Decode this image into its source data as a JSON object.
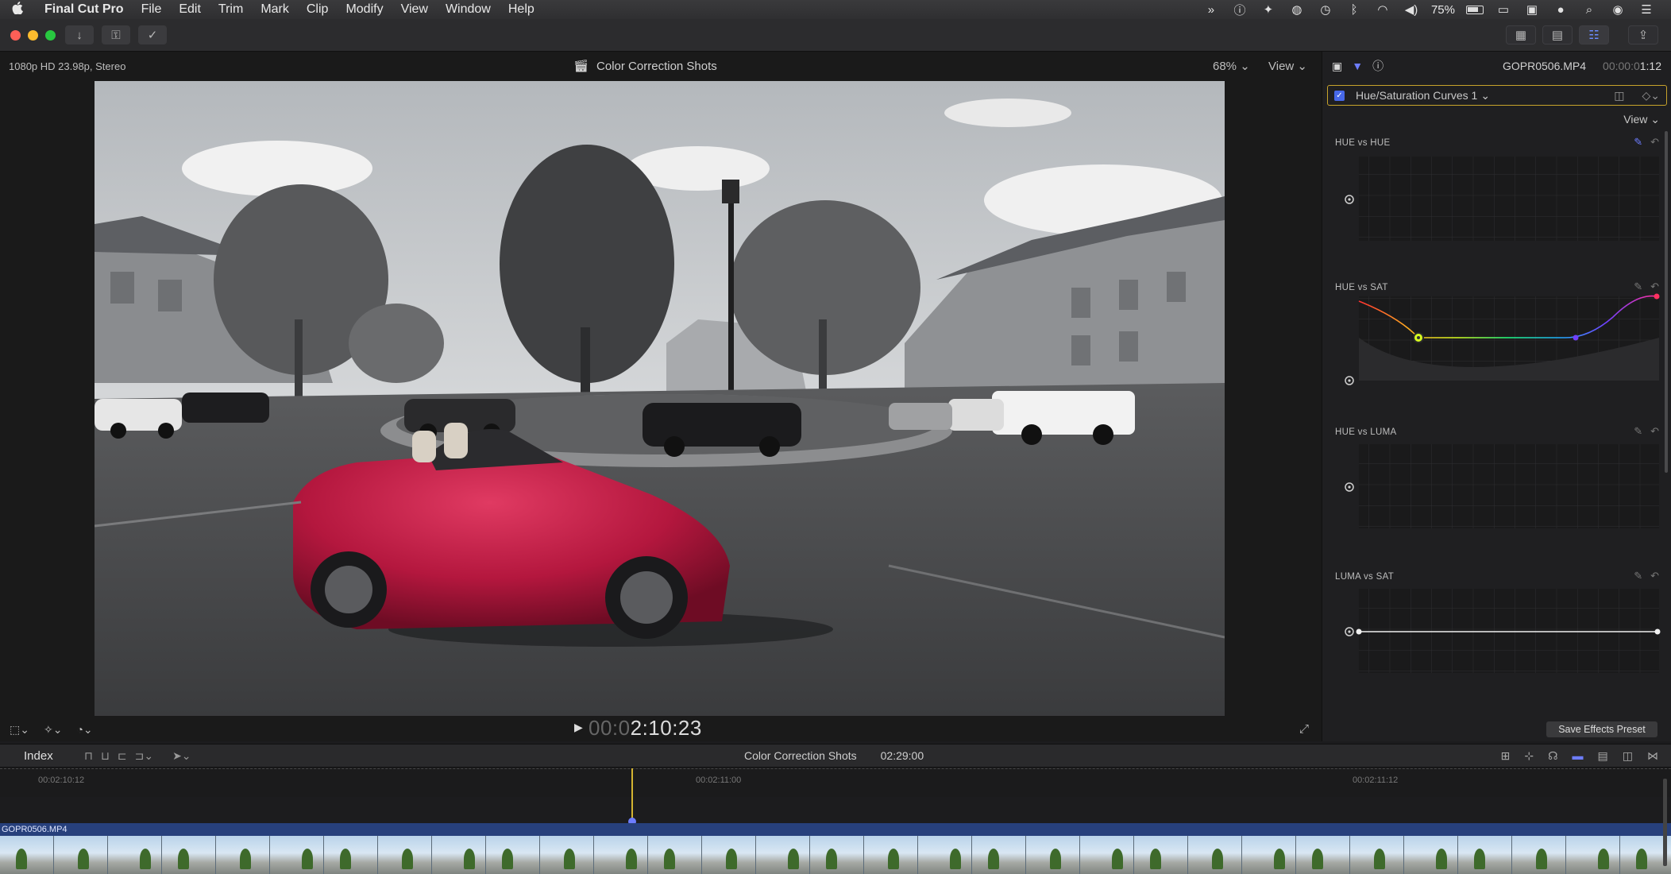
{
  "menubar": {
    "apple": "",
    "app_name": "Final Cut Pro",
    "items": [
      "File",
      "Edit",
      "Trim",
      "Mark",
      "Clip",
      "Modify",
      "View",
      "Window",
      "Help"
    ],
    "battery": "75%"
  },
  "viewer": {
    "format": "1080p HD 23.98p, Stereo",
    "project": "Color Correction Shots",
    "zoom": "68%",
    "view_menu": "View"
  },
  "inspector": {
    "clip_name": "GOPR0506.MP4",
    "timecode_dim": "00:00:0",
    "timecode": "1:12",
    "effect_name": "Hue/Saturation Curves 1",
    "view_menu": "View",
    "curves": [
      {
        "title": "HUE vs HUE"
      },
      {
        "title": "HUE vs SAT"
      },
      {
        "title": "HUE vs LUMA"
      },
      {
        "title": "LUMA vs SAT"
      }
    ],
    "save_preset": "Save Effects Preset"
  },
  "playback": {
    "timecode_dim": "00:0",
    "timecode": "2:10:23"
  },
  "timeline": {
    "index": "Index",
    "project": "Color Correction Shots",
    "duration": "02:29:00",
    "ruler": [
      "00:02:10:12",
      "00:02:11:00",
      "00:02:11:12"
    ],
    "clip_name": "GOPR0506.MP4"
  },
  "colors": {
    "accent": "#6d7dff",
    "selection": "#c7a32b",
    "car": "#b4173e",
    "clip": "#27407c"
  }
}
